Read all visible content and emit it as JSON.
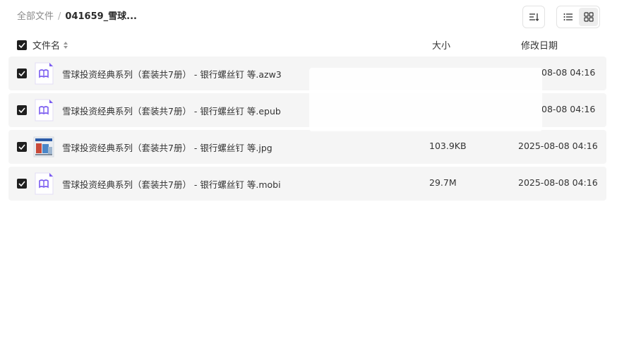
{
  "breadcrumb": {
    "root": "全部文件",
    "separator": "/",
    "current": "041659_雪球..."
  },
  "toolbar": {
    "sort_icon": "sort-lines-icon",
    "views": [
      {
        "icon": "list-view-icon",
        "active": false
      },
      {
        "icon": "grid-view-icon",
        "active": true
      }
    ]
  },
  "columns": {
    "name": "文件名",
    "size": "大小",
    "date": "修改日期"
  },
  "files": [
    {
      "name": "雪球投资经典系列（套装共7册） - 银行螺丝钉 等.azw3",
      "size": "",
      "date": "08-08 04:16",
      "icon": "book-file-icon"
    },
    {
      "name": "雪球投资经典系列（套装共7册） - 银行螺丝钉 等.epub",
      "size": "",
      "date": "08-08 04:16",
      "icon": "book-file-icon"
    },
    {
      "name": "雪球投资经典系列（套装共7册） - 银行螺丝钉 等.jpg",
      "size": "103.9KB",
      "date": "2025-08-08 04:16",
      "icon": "image-thumbnail-icon"
    },
    {
      "name": "雪球投资经典系列（套装共7册） - 银行螺丝钉 等.mobi",
      "size": "29.7M",
      "date": "2025-08-08 04:16",
      "icon": "book-file-icon"
    }
  ],
  "colors": {
    "row_bg": "#f5f5f5",
    "book_icon": "#7a5cf0",
    "checkbox": "#1f1f1f"
  }
}
